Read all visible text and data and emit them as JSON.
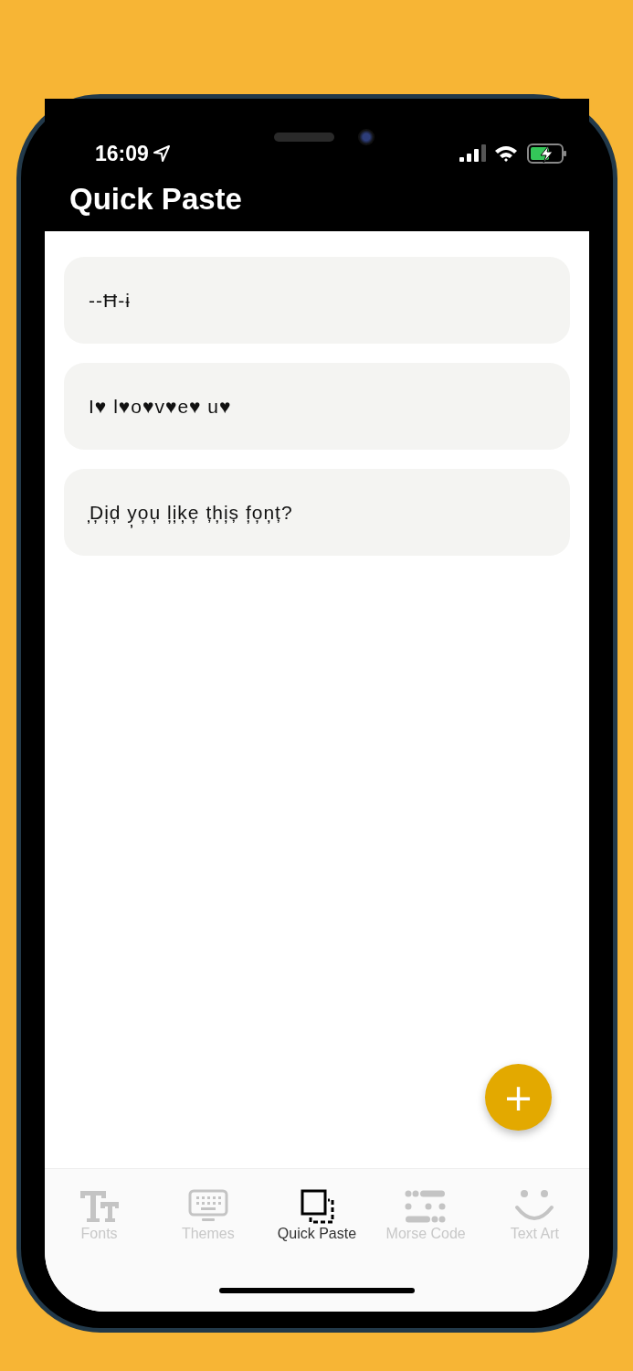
{
  "status_bar": {
    "time": "16:09"
  },
  "title": "Quick Paste",
  "items": [
    {
      "text": "--Ħ-ɨ"
    },
    {
      "text": "I♥ l♥o♥v♥e♥ u♥"
    },
    {
      "text": "̦D̦i̦d̦ y̦o̦u̦ l̦i̦k̦e̦ țh̦i̦ș  f̦o̦n̦ț?"
    }
  ],
  "fab": "+",
  "tabs": [
    {
      "label": "Fonts",
      "kind": "fonts",
      "selected": false
    },
    {
      "label": "Themes",
      "kind": "keyboard",
      "selected": false
    },
    {
      "label": "Quick Paste",
      "kind": "paste",
      "selected": true
    },
    {
      "label": "Morse Code",
      "kind": "morse",
      "selected": false
    },
    {
      "label": "Text Art",
      "kind": "smile",
      "selected": false
    }
  ]
}
